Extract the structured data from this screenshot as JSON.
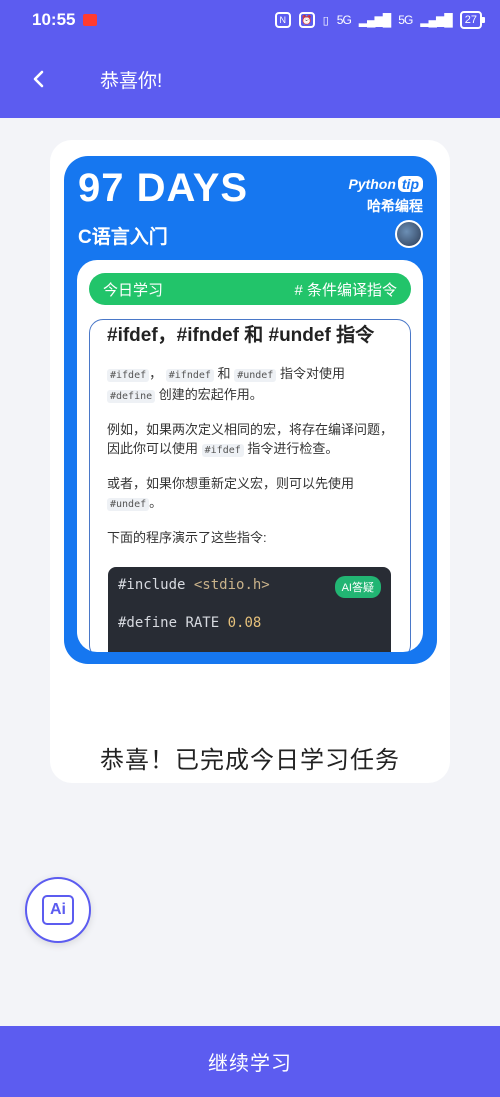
{
  "status_bar": {
    "time": "10:55",
    "notif_label": "今日头条",
    "network_label": "5G",
    "battery": "27"
  },
  "app_bar": {
    "title": "恭喜你!"
  },
  "card": {
    "days": "97 DAYS",
    "course": "C语言入门",
    "brand_python": "Python",
    "brand_tip": "tip",
    "brand_name": "哈希编程",
    "study_label": "今日学习",
    "topic": "# 条件编译指令",
    "lesson_title": "#ifdef，#ifndef 和 #undef 指令",
    "p1_code1": "#ifdef",
    "p1_sep1": "，",
    "p1_code2": "#ifndef",
    "p1_and": "和",
    "p1_code3": "#undef",
    "p1_text1": "指令对使用",
    "p1_code4": "#define",
    "p1_text2": "创建的宏起作用。",
    "p2_text1": "例如，如果两次定义相同的宏，将存在编译问题，因此你可以使用",
    "p2_code": "#ifdef",
    "p2_text2": "指令进行检查。",
    "p3_text1": "或者，如果你想重新定义宏，则可以先使用",
    "p3_code": "#undef",
    "p3_text2": "。",
    "p4_text": "下面的程序演示了这些指令:",
    "code_include": "#include",
    "code_header": "<stdio.h>",
    "code_define": "#define",
    "code_name": "RATE",
    "code_value": "0.08",
    "ai_tag": "AI答疑"
  },
  "congrats_text": "恭喜！已完成今日学习任务",
  "ai_fab_label": "Ai",
  "continue_button": "继续学习",
  "colors": {
    "primary": "#5c5cf0",
    "card_blue": "#1677f0",
    "green": "#22c46a"
  }
}
